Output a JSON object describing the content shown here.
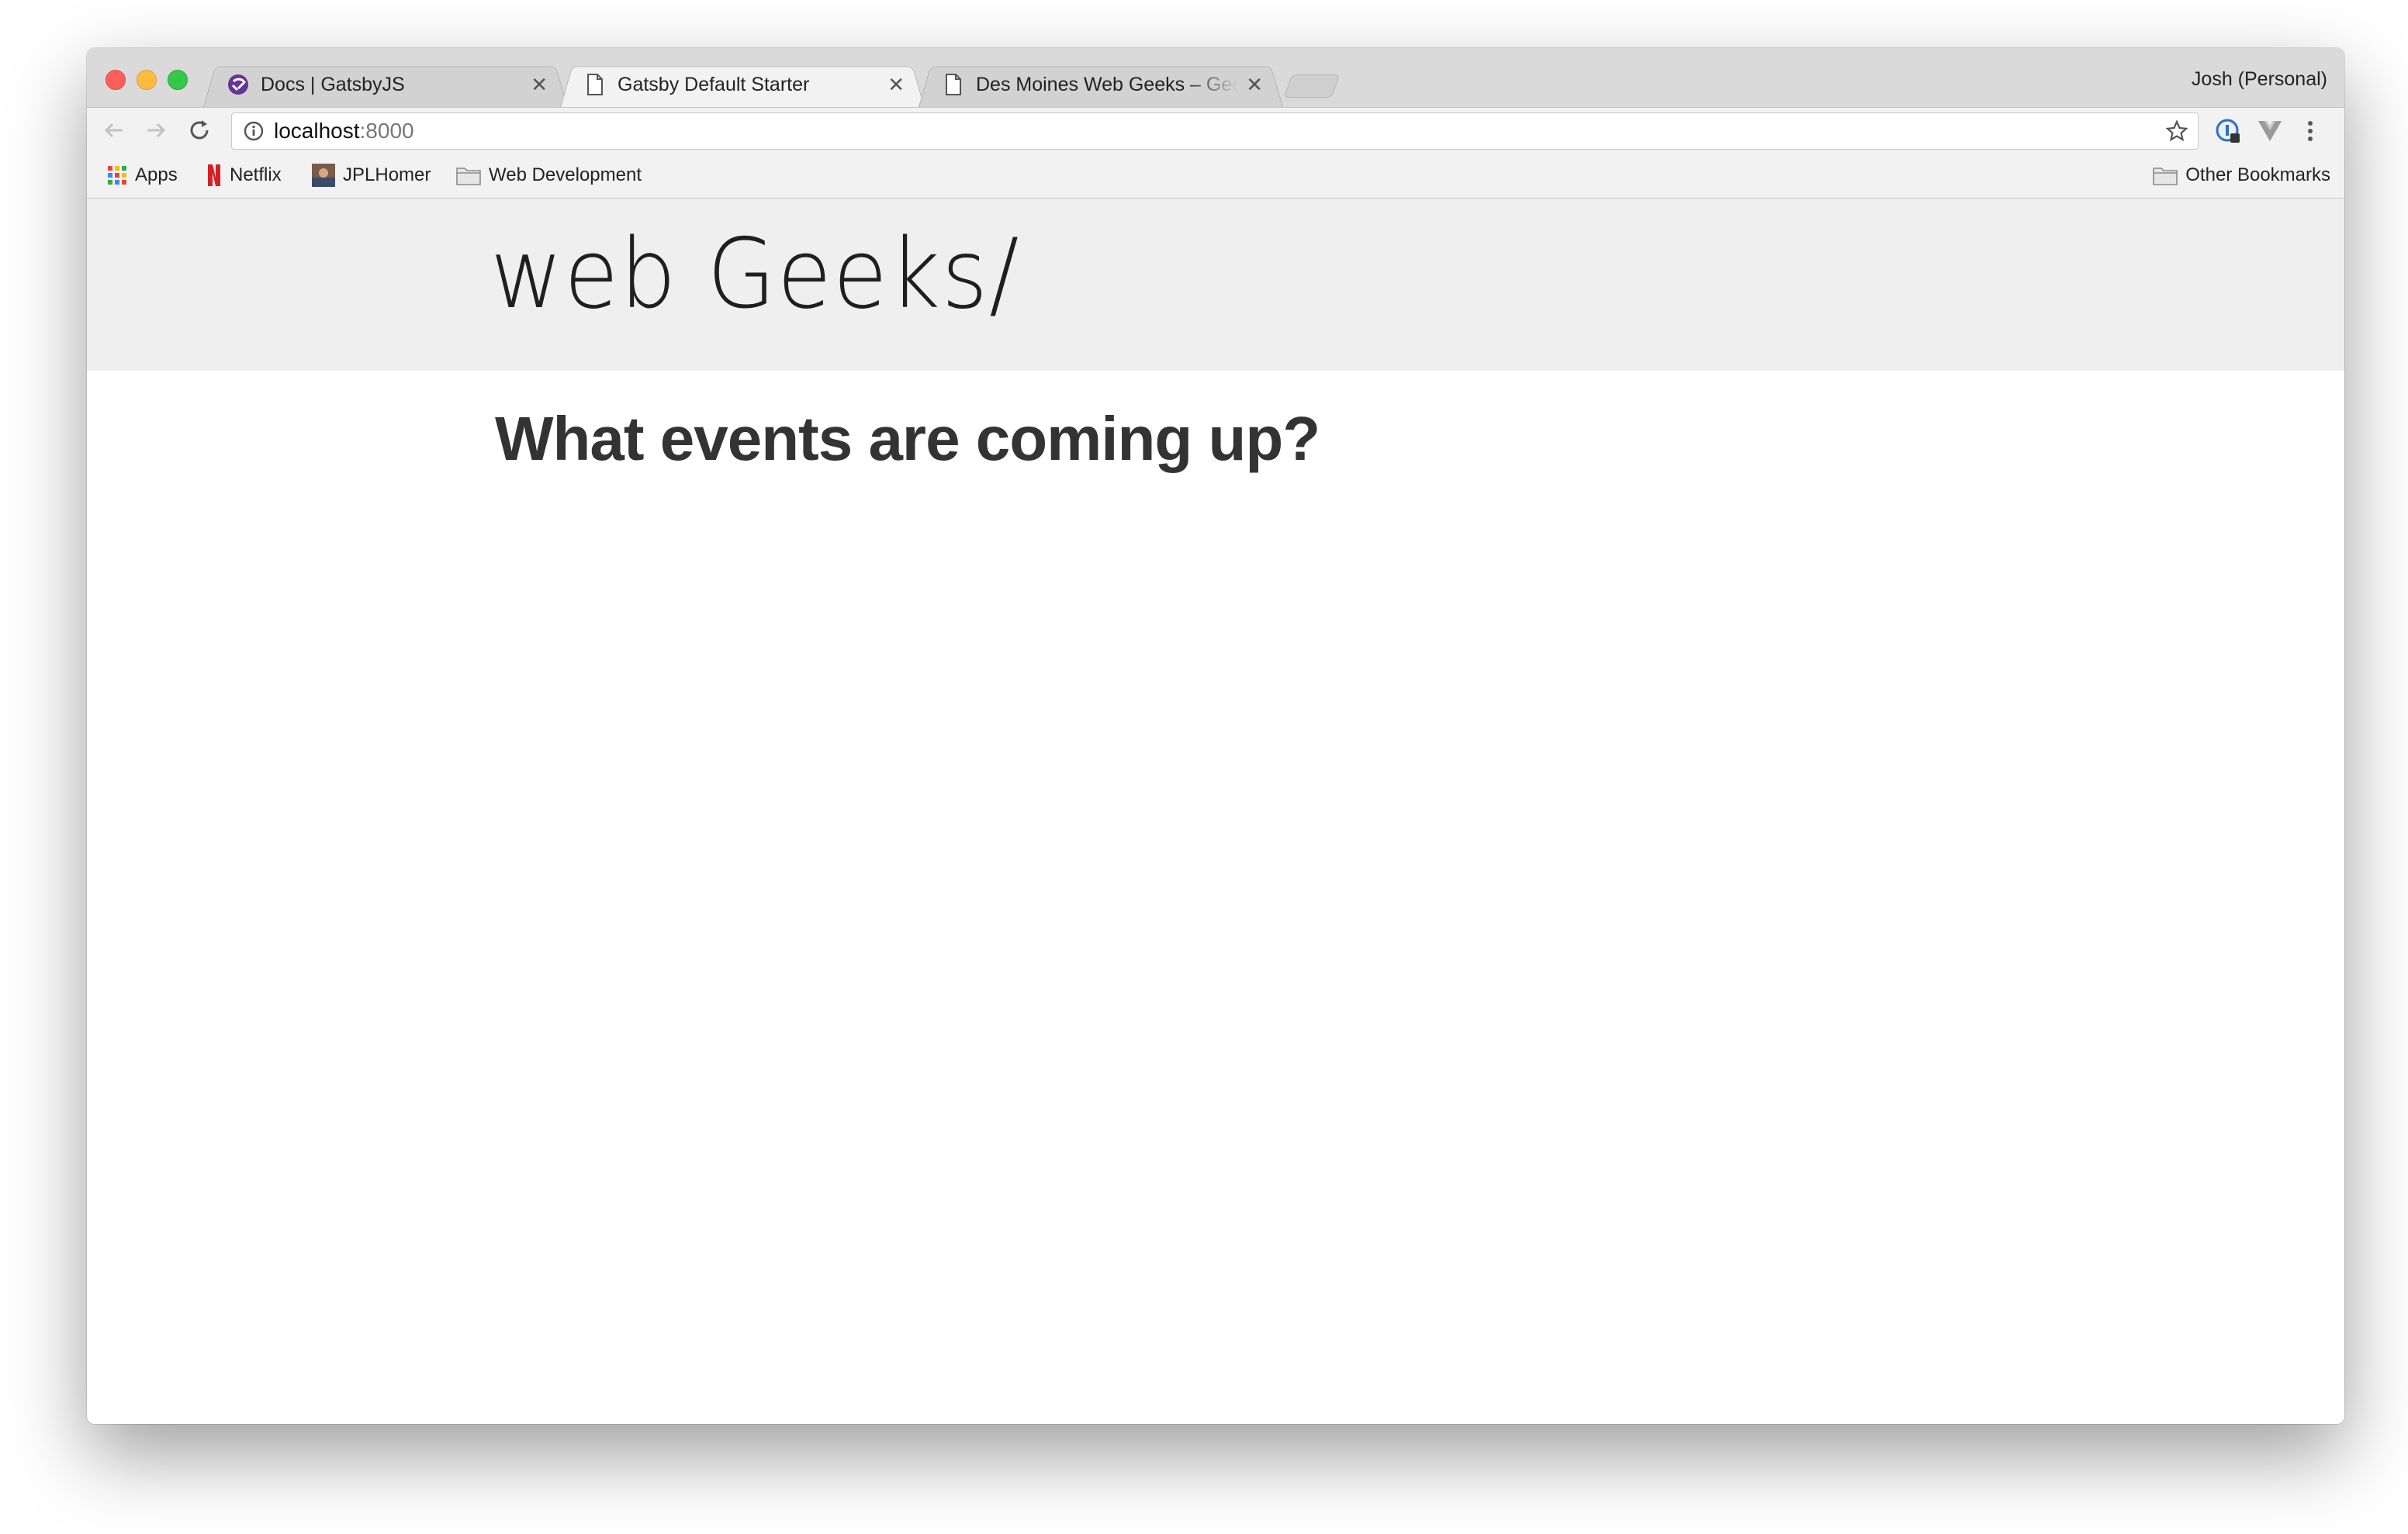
{
  "browser": {
    "tabs": [
      {
        "title": "Docs | GatsbyJS",
        "favicon": "gatsby-icon"
      },
      {
        "title": "Gatsby Default Starter",
        "favicon": "page-icon"
      },
      {
        "title": "Des Moines Web Geeks – Geek",
        "favicon": "page-icon"
      }
    ],
    "profile": "Josh (Personal)",
    "address": {
      "host": "localhost",
      "port": ":8000"
    }
  },
  "bookmarks": {
    "items": [
      {
        "label": "Apps",
        "icon": "apps-grid-icon"
      },
      {
        "label": "Netflix",
        "icon": "netflix-icon"
      },
      {
        "label": "JPLHomer",
        "icon": "jplhomer-avatar-icon"
      },
      {
        "label": "Web Development",
        "icon": "folder-icon"
      }
    ],
    "other": "Other Bookmarks"
  },
  "page": {
    "logo": "web Geeks/",
    "headline": "What events are coming up?"
  },
  "colors": {
    "header_bg": "#efefef",
    "headline": "#333333"
  }
}
